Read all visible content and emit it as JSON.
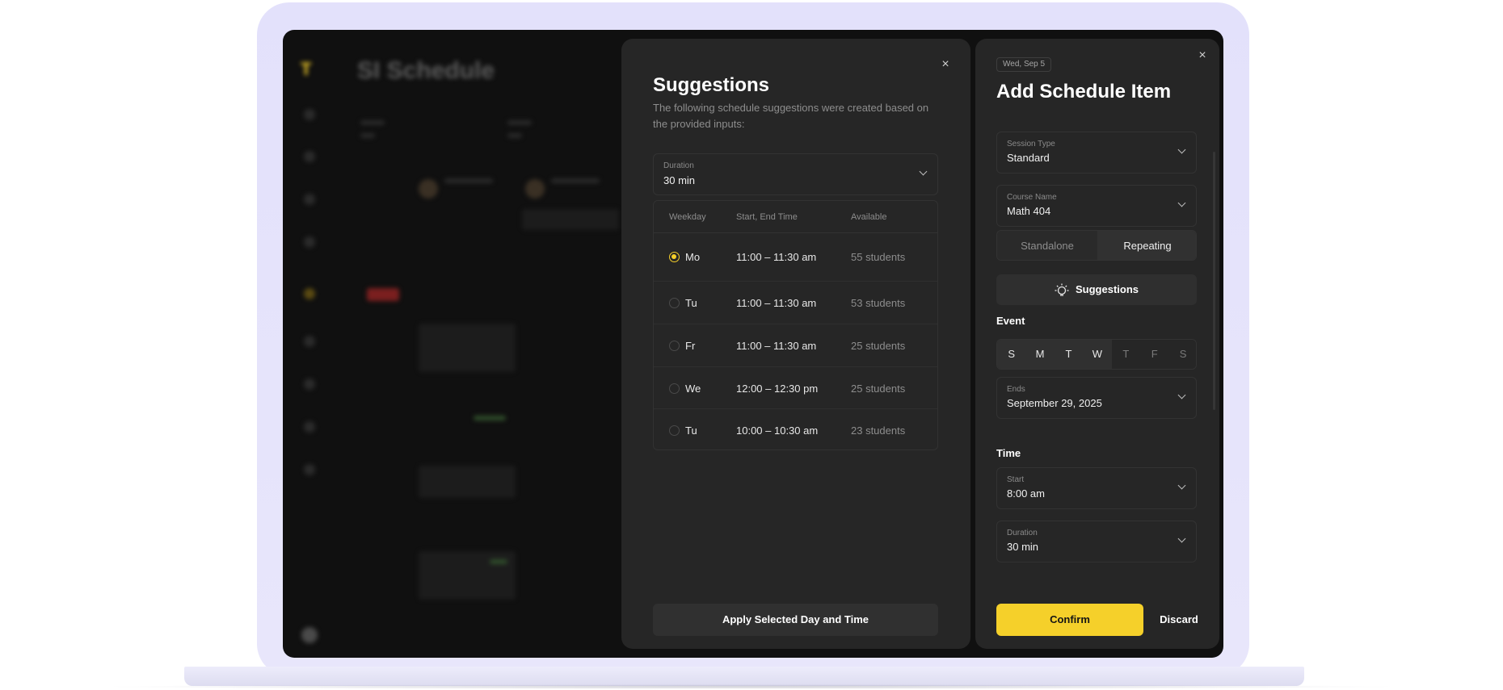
{
  "background_app": {
    "title": "SI Schedule",
    "logo": "T"
  },
  "suggestions": {
    "title": "Suggestions",
    "description": "The following schedule suggestions were created based on the provided inputs:",
    "close_icon": "×",
    "duration": {
      "label": "Duration",
      "value": "30 min"
    },
    "table": {
      "headers": {
        "weekday": "Weekday",
        "time": "Start, End Time",
        "available": "Available"
      },
      "rows": [
        {
          "day": "Mo",
          "time": "11:00 – 11:30 am",
          "available": "55 students",
          "selected": true
        },
        {
          "day": "Tu",
          "time": "11:00 – 11:30 am",
          "available": "53 students",
          "selected": false
        },
        {
          "day": "Fr",
          "time": "11:00 – 11:30 am",
          "available": "25 students",
          "selected": false
        },
        {
          "day": "We",
          "time": "12:00 – 12:30 pm",
          "available": "25 students",
          "selected": false
        },
        {
          "day": "Tu",
          "time": "10:00 – 10:30 am",
          "available": "23 students",
          "selected": false
        }
      ]
    },
    "apply_label": "Apply Selected Day and Time"
  },
  "add_item": {
    "date": "Wed, Sep 5",
    "title": "Add Schedule Item",
    "close_icon": "×",
    "session_type": {
      "label": "Session Type",
      "value": "Standard"
    },
    "course_name": {
      "label": "Course Name",
      "value": "Math 404"
    },
    "mode": {
      "standalone": "Standalone",
      "repeating": "Repeating",
      "selected": "Repeating"
    },
    "suggestions_label": "Suggestions",
    "event_label": "Event",
    "weekdays": [
      {
        "label": "S",
        "active": true
      },
      {
        "label": "M",
        "active": true
      },
      {
        "label": "T",
        "active": true
      },
      {
        "label": "W",
        "active": true
      },
      {
        "label": "T",
        "active": false
      },
      {
        "label": "F",
        "active": false
      },
      {
        "label": "S",
        "active": false
      }
    ],
    "ends": {
      "label": "Ends",
      "value": "September 29, 2025"
    },
    "time_label": "Time",
    "start": {
      "label": "Start",
      "value": "8:00 am"
    },
    "duration": {
      "label": "Duration",
      "value": "30 min"
    },
    "confirm_label": "Confirm",
    "discard_label": "Discard"
  },
  "colors": {
    "accent": "#f5d02a",
    "panel": "#262626",
    "screen": "#101010",
    "frame": "#e3e1fb"
  }
}
